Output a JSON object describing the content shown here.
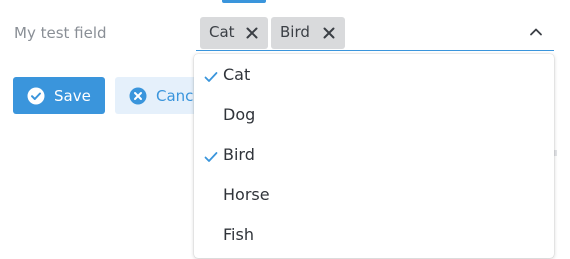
{
  "field": {
    "label": "My test field"
  },
  "selected_chips": [
    {
      "label": "Cat"
    },
    {
      "label": "Bird"
    }
  ],
  "options": [
    {
      "label": "Cat",
      "selected": true
    },
    {
      "label": "Dog",
      "selected": false
    },
    {
      "label": "Bird",
      "selected": true
    },
    {
      "label": "Horse",
      "selected": false
    },
    {
      "label": "Fish",
      "selected": false
    }
  ],
  "actions": {
    "save_label": "Save",
    "cancel_label": "Cancel"
  },
  "colors": {
    "accent": "#3a95dc",
    "chip_bg": "#d9dadc",
    "cancel_bg": "#e5f0fb"
  },
  "icons": {
    "chip_remove": "close-icon",
    "dropdown_toggle": "chevron-up-icon",
    "option_selected": "check-icon",
    "save": "check-circle-icon",
    "cancel": "close-circle-icon"
  }
}
